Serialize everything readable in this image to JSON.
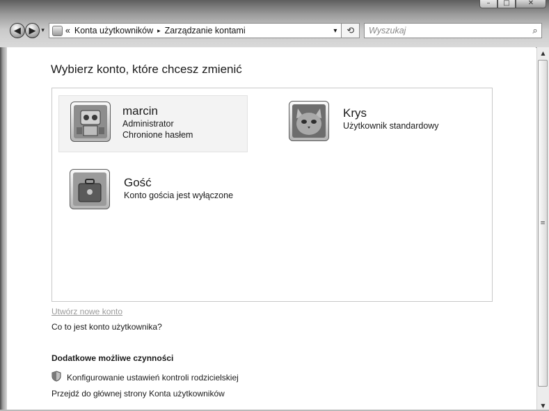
{
  "window": {
    "caption_buttons": [
      "–",
      "□",
      "✕"
    ]
  },
  "nav": {
    "back_label": "◀",
    "forward_label": "▶",
    "history_label": "▾",
    "breadcrumb": {
      "overflow": "«",
      "items": [
        "Konta użytkowników",
        "Zarządzanie kontami"
      ],
      "separator": "▸",
      "dropdown_label": "▾"
    },
    "refresh_label": "⟲",
    "search": {
      "placeholder": "Wyszukaj",
      "value": "",
      "button_label": "⌕"
    }
  },
  "main": {
    "title": "Wybierz konto, które chcesz zmienić",
    "accounts": [
      {
        "name": "marcin",
        "lines": [
          "Administrator",
          "Chronione hasłem"
        ],
        "icon": "robot-avatar-icon",
        "selected": true
      },
      {
        "name": "Krys",
        "lines": [
          "Użytkownik standardowy"
        ],
        "icon": "kitten-avatar-icon",
        "selected": false
      },
      {
        "name": "Gość",
        "lines": [
          "Konto gościa jest wyłączone"
        ],
        "icon": "guest-briefcase-icon",
        "selected": false
      }
    ],
    "create_account_link": "Utwórz nowe konto",
    "what_is_account_link": "Co to jest konto użytkownika?",
    "additional_title": "Dodatkowe możliwe czynności",
    "tasks": [
      {
        "label": "Konfigurowanie ustawień kontroli rodzicielskiej",
        "icon": "shield-icon"
      },
      {
        "label": "Przejdź do głównej strony Konta użytkowników"
      }
    ]
  },
  "scrollbar": {
    "up_label": "▲",
    "down_label": "▼",
    "grip_label": "≡"
  },
  "colors": {
    "link_disabled": "#9a9a9a",
    "text": "#1a1a1a",
    "panel_border": "#c8c8c8"
  }
}
